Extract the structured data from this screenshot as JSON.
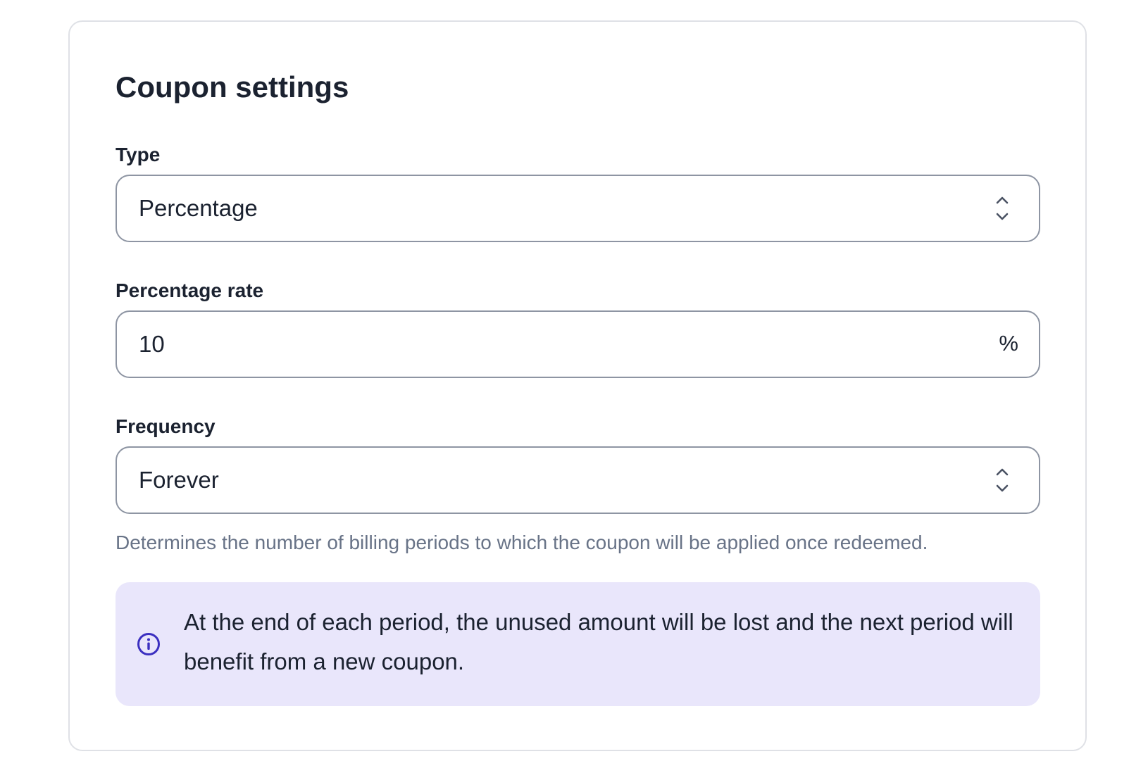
{
  "card": {
    "title": "Coupon settings"
  },
  "type_field": {
    "label": "Type",
    "value": "Percentage",
    "icon": "chevron-up-down-icon"
  },
  "rate_field": {
    "label": "Percentage rate",
    "value": "10",
    "suffix": "%"
  },
  "frequency_field": {
    "label": "Frequency",
    "value": "Forever",
    "icon": "chevron-up-down-icon",
    "help": "Determines the number of billing periods to which the coupon will be applied once redeemed."
  },
  "info_banner": {
    "icon": "info-icon",
    "text": "At the end of each period, the unused amount will be lost and the next period will benefit from a new coupon."
  },
  "colors": {
    "text": "#1b2230",
    "muted": "#687387",
    "border": "#8e95a3",
    "card_border": "#dfe1e6",
    "info_bg": "#e9e6fb",
    "info_icon": "#3b2fc0"
  }
}
